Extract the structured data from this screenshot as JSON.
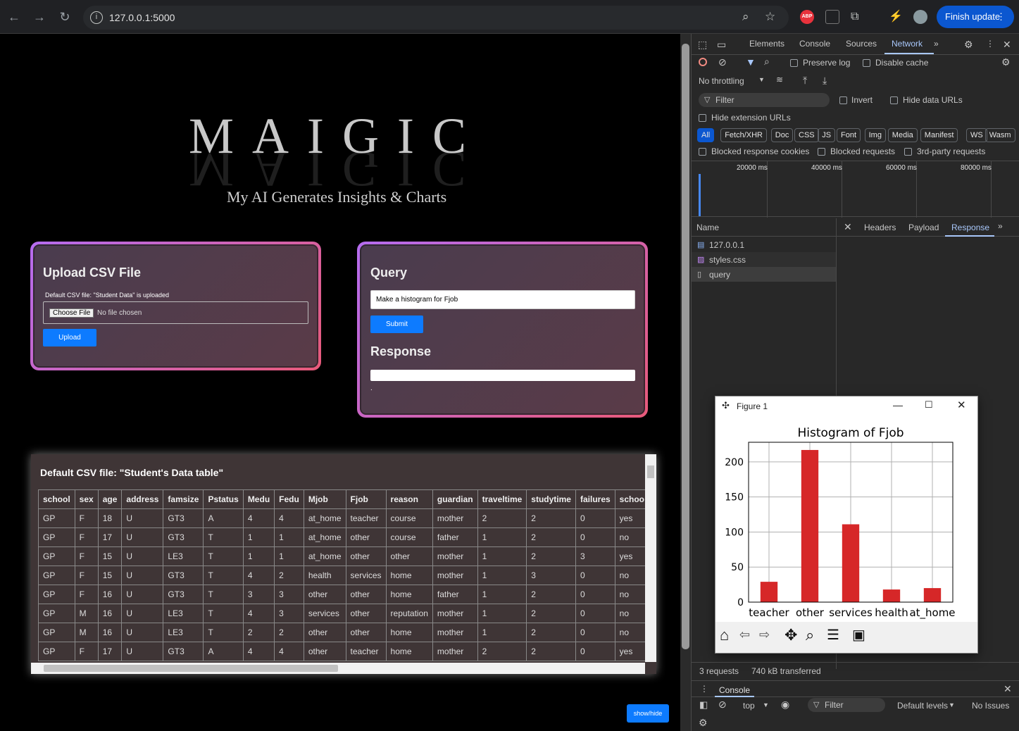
{
  "browser": {
    "url": "127.0.0.1:5000",
    "finish_update": "Finish update"
  },
  "page": {
    "logo": "MAIGIC",
    "tagline": "My AI Generates Insights & Charts",
    "upload": {
      "title": "Upload CSV File",
      "default_note": "Default CSV file: \"Student Data\" is uploaded",
      "choose_file": "Choose File",
      "no_file": "No file chosen",
      "upload_btn": "Upload"
    },
    "query": {
      "title": "Query",
      "input_value": "Make a histogram for Fjob",
      "submit": "Submit",
      "response_title": "Response",
      "response_dot": "."
    },
    "table": {
      "title": "Default CSV file: \"Student's Data table\"",
      "headers": [
        "school",
        "sex",
        "age",
        "address",
        "famsize",
        "Pstatus",
        "Medu",
        "Fedu",
        "Mjob",
        "Fjob",
        "reason",
        "guardian",
        "traveltime",
        "studytime",
        "failures",
        "schoo"
      ],
      "rows": [
        [
          "GP",
          "F",
          "18",
          "U",
          "GT3",
          "A",
          "4",
          "4",
          "at_home",
          "teacher",
          "course",
          "mother",
          "2",
          "2",
          "0",
          "yes"
        ],
        [
          "GP",
          "F",
          "17",
          "U",
          "GT3",
          "T",
          "1",
          "1",
          "at_home",
          "other",
          "course",
          "father",
          "1",
          "2",
          "0",
          "no"
        ],
        [
          "GP",
          "F",
          "15",
          "U",
          "LE3",
          "T",
          "1",
          "1",
          "at_home",
          "other",
          "other",
          "mother",
          "1",
          "2",
          "3",
          "yes"
        ],
        [
          "GP",
          "F",
          "15",
          "U",
          "GT3",
          "T",
          "4",
          "2",
          "health",
          "services",
          "home",
          "mother",
          "1",
          "3",
          "0",
          "no"
        ],
        [
          "GP",
          "F",
          "16",
          "U",
          "GT3",
          "T",
          "3",
          "3",
          "other",
          "other",
          "home",
          "father",
          "1",
          "2",
          "0",
          "no"
        ],
        [
          "GP",
          "M",
          "16",
          "U",
          "LE3",
          "T",
          "4",
          "3",
          "services",
          "other",
          "reputation",
          "mother",
          "1",
          "2",
          "0",
          "no"
        ],
        [
          "GP",
          "M",
          "16",
          "U",
          "LE3",
          "T",
          "2",
          "2",
          "other",
          "other",
          "home",
          "mother",
          "1",
          "2",
          "0",
          "no"
        ],
        [
          "GP",
          "F",
          "17",
          "U",
          "GT3",
          "A",
          "4",
          "4",
          "other",
          "teacher",
          "home",
          "mother",
          "2",
          "2",
          "0",
          "yes"
        ]
      ]
    },
    "showhide": "show/hide"
  },
  "devtools": {
    "tabs": [
      "Elements",
      "Console",
      "Sources",
      "Network"
    ],
    "preserve_log": "Preserve log",
    "disable_cache": "Disable cache",
    "throttling": "No throttling",
    "filter": "Filter",
    "invert": "Invert",
    "hide_data_urls": "Hide data URLs",
    "hide_ext": "Hide extension URLs",
    "types": [
      "All",
      "Fetch/XHR",
      "Doc",
      "CSS",
      "JS",
      "Font",
      "Img",
      "Media",
      "Manifest",
      "WS",
      "Wasm"
    ],
    "blocked_cookies": "Blocked response cookies",
    "blocked_requests": "Blocked requests",
    "third_party": "3rd-party requests",
    "timeline": [
      "20000 ms",
      "40000 ms",
      "60000 ms",
      "80000 ms"
    ],
    "name_col": "Name",
    "detail_tabs": [
      "Headers",
      "Payload",
      "Response"
    ],
    "requests": [
      "127.0.0.1",
      "styles.css",
      "query"
    ],
    "status": "3 requests",
    "transferred": "740 kB transferred",
    "console_tab": "Console",
    "top": "top",
    "console_filter": "Filter",
    "levels": "Default levels",
    "issues": "No Issues"
  },
  "figure": {
    "window_title": "Figure 1"
  },
  "chart_data": {
    "type": "bar",
    "title": "Histogram of Fjob",
    "categories": [
      "teacher",
      "other",
      "services",
      "health",
      "at_home"
    ],
    "values": [
      29,
      217,
      111,
      18,
      20
    ],
    "ylim": [
      0,
      228
    ],
    "yticks": [
      0,
      50,
      100,
      150,
      200
    ],
    "bar_color": "#d62728"
  }
}
